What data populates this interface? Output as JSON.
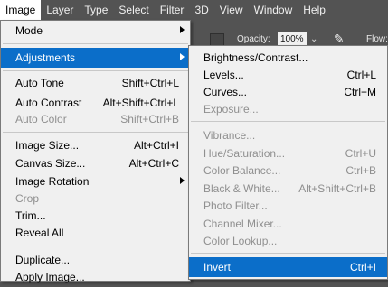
{
  "menubar": [
    "Image",
    "Layer",
    "Type",
    "Select",
    "Filter",
    "3D",
    "View",
    "Window",
    "Help"
  ],
  "options_bar": {
    "opacity_label": "Opacity:",
    "opacity_value": "100%",
    "flow_label": "Flow:"
  },
  "image_menu": [
    {
      "label": "Mode",
      "shortcut": "",
      "submenu": true,
      "disabled": false
    },
    {
      "label": "Adjustments",
      "shortcut": "",
      "submenu": true,
      "disabled": false,
      "highlighted": true
    },
    {
      "label": "Auto Tone",
      "shortcut": "Shift+Ctrl+L",
      "disabled": false
    },
    {
      "label": "Auto Contrast",
      "shortcut": "Alt+Shift+Ctrl+L",
      "disabled": false
    },
    {
      "label": "Auto Color",
      "shortcut": "Shift+Ctrl+B",
      "disabled": true
    },
    {
      "label": "Image Size...",
      "shortcut": "Alt+Ctrl+I",
      "disabled": false
    },
    {
      "label": "Canvas Size...",
      "shortcut": "Alt+Ctrl+C",
      "disabled": false
    },
    {
      "label": "Image Rotation",
      "shortcut": "",
      "submenu": true,
      "disabled": false
    },
    {
      "label": "Crop",
      "shortcut": "",
      "disabled": true
    },
    {
      "label": "Trim...",
      "shortcut": "",
      "disabled": false
    },
    {
      "label": "Reveal All",
      "shortcut": "",
      "disabled": false
    },
    {
      "label": "Duplicate...",
      "shortcut": "",
      "disabled": false
    },
    {
      "label": "Apply Image...",
      "shortcut": "",
      "disabled": false
    }
  ],
  "adjustments_menu": [
    {
      "label": "Brightness/Contrast...",
      "shortcut": "",
      "disabled": false
    },
    {
      "label": "Levels...",
      "shortcut": "Ctrl+L",
      "disabled": false
    },
    {
      "label": "Curves...",
      "shortcut": "Ctrl+M",
      "disabled": false
    },
    {
      "label": "Exposure...",
      "shortcut": "",
      "disabled": true
    },
    {
      "label": "Vibrance...",
      "shortcut": "",
      "disabled": true
    },
    {
      "label": "Hue/Saturation...",
      "shortcut": "Ctrl+U",
      "disabled": true
    },
    {
      "label": "Color Balance...",
      "shortcut": "Ctrl+B",
      "disabled": true
    },
    {
      "label": "Black & White...",
      "shortcut": "Alt+Shift+Ctrl+B",
      "disabled": true
    },
    {
      "label": "Photo Filter...",
      "shortcut": "",
      "disabled": true
    },
    {
      "label": "Channel Mixer...",
      "shortcut": "",
      "disabled": true
    },
    {
      "label": "Color Lookup...",
      "shortcut": "",
      "disabled": true
    },
    {
      "label": "Invert",
      "shortcut": "Ctrl+I",
      "disabled": false,
      "highlighted": true
    }
  ],
  "colors": {
    "highlight": "#0b6ec9",
    "menu_bg": "#f0f0f0",
    "app_bg": "#535353",
    "disabled_text": "#8f8f8f"
  }
}
